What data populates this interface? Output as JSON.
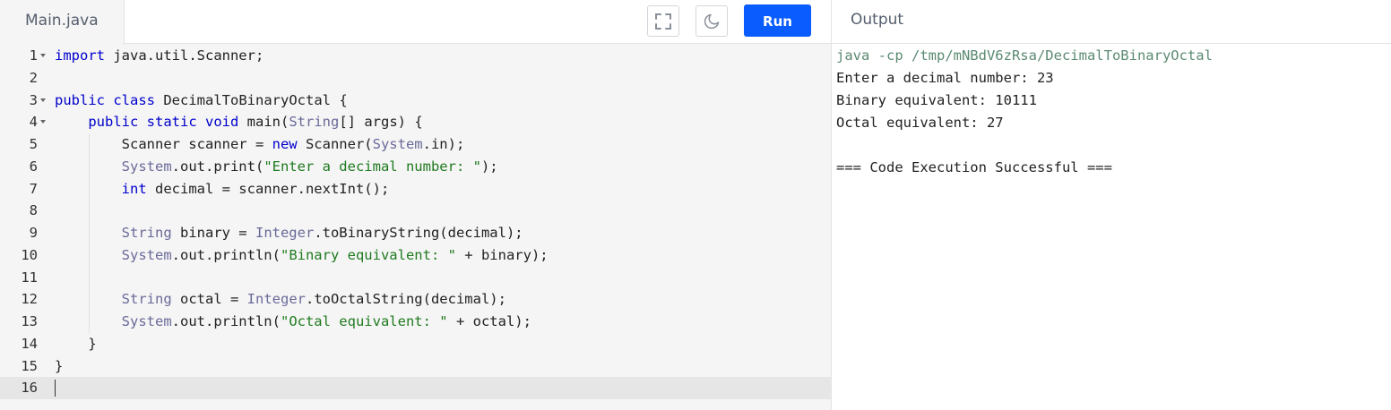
{
  "editor": {
    "file_tab": "Main.java",
    "run_label": "Run",
    "lines": [
      {
        "num": "1",
        "fold": true
      },
      {
        "num": "2",
        "fold": false
      },
      {
        "num": "3",
        "fold": true
      },
      {
        "num": "4",
        "fold": true
      },
      {
        "num": "5",
        "fold": false
      },
      {
        "num": "6",
        "fold": false
      },
      {
        "num": "7",
        "fold": false
      },
      {
        "num": "8",
        "fold": false
      },
      {
        "num": "9",
        "fold": false
      },
      {
        "num": "10",
        "fold": false
      },
      {
        "num": "11",
        "fold": false
      },
      {
        "num": "12",
        "fold": false
      },
      {
        "num": "13",
        "fold": false
      },
      {
        "num": "14",
        "fold": false
      },
      {
        "num": "15",
        "fold": false
      },
      {
        "num": "16",
        "fold": false
      }
    ],
    "code": [
      [
        [
          "kw",
          "import"
        ],
        [
          "",
          " java.util.Scanner;"
        ]
      ],
      [],
      [
        [
          "kw",
          "public"
        ],
        [
          "",
          " "
        ],
        [
          "kw",
          "class"
        ],
        [
          "",
          " DecimalToBinaryOctal {"
        ]
      ],
      [
        [
          "",
          "    "
        ],
        [
          "kw",
          "public"
        ],
        [
          "",
          " "
        ],
        [
          "kw",
          "static"
        ],
        [
          "",
          " "
        ],
        [
          "kw",
          "void"
        ],
        [
          "",
          " main("
        ],
        [
          "ty",
          "String"
        ],
        [
          "",
          "[] args) {"
        ]
      ],
      [
        [
          "",
          "        Scanner scanner = "
        ],
        [
          "kw",
          "new"
        ],
        [
          "",
          " Scanner("
        ],
        [
          "ty",
          "System"
        ],
        [
          "",
          ".in);"
        ]
      ],
      [
        [
          "",
          "        "
        ],
        [
          "ty",
          "System"
        ],
        [
          "",
          ".out.print("
        ],
        [
          "str",
          "\"Enter a decimal number: \""
        ],
        [
          "",
          ");"
        ]
      ],
      [
        [
          "",
          "        "
        ],
        [
          "kw",
          "int"
        ],
        [
          "",
          " decimal = scanner.nextInt();"
        ]
      ],
      [],
      [
        [
          "",
          "        "
        ],
        [
          "ty",
          "String"
        ],
        [
          "",
          " binary = "
        ],
        [
          "ty",
          "Integer"
        ],
        [
          "",
          ".toBinaryString(decimal);"
        ]
      ],
      [
        [
          "",
          "        "
        ],
        [
          "ty",
          "System"
        ],
        [
          "",
          ".out.println("
        ],
        [
          "str",
          "\"Binary equivalent: \""
        ],
        [
          "",
          " + binary);"
        ]
      ],
      [],
      [
        [
          "",
          "        "
        ],
        [
          "ty",
          "String"
        ],
        [
          "",
          " octal = "
        ],
        [
          "ty",
          "Integer"
        ],
        [
          "",
          ".toOctalString(decimal);"
        ]
      ],
      [
        [
          "",
          "        "
        ],
        [
          "ty",
          "System"
        ],
        [
          "",
          ".out.println("
        ],
        [
          "str",
          "\"Octal equivalent: \""
        ],
        [
          "",
          " + octal);"
        ]
      ],
      [
        [
          "",
          "    }"
        ]
      ],
      [
        [
          "",
          "}"
        ]
      ],
      []
    ],
    "active_line": 16
  },
  "output": {
    "title": "Output",
    "lines": [
      "java -cp /tmp/mNBdV6zRsa/DecimalToBinaryOctal",
      "Enter a decimal number: 23",
      "Binary equivalent: 10111",
      "Octal equivalent: 27",
      "",
      "=== Code Execution Successful ==="
    ]
  },
  "colors": {
    "run_button": "#0b5cff",
    "keyword": "#0000cc",
    "string": "#1f7a1f",
    "type": "#6a6a9a",
    "command": "#5b8a72"
  },
  "icons": [
    "fullscreen-icon",
    "moon-icon",
    "fold-arrow-icon"
  ]
}
